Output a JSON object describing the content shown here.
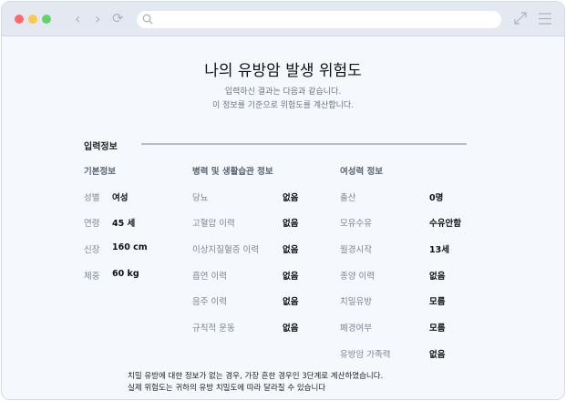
{
  "browser": {
    "controls": [
      "close",
      "minimize",
      "maximize"
    ],
    "url": ""
  },
  "page": {
    "title": "나의 유방암 발생 위험도",
    "subtitle_lines": [
      "입력하신 결과는 다음과 같습니다.",
      "이 정보를 기준으로 위험도를 계산합니다."
    ],
    "section_title": "입력정보"
  },
  "basic": {
    "heading": "기본정보",
    "rows": [
      {
        "label": "성별",
        "value": "여성"
      },
      {
        "label": "연령",
        "value": "45 세"
      },
      {
        "label": "신장",
        "value": "160 cm"
      },
      {
        "label": "체중",
        "value": "60 kg"
      }
    ]
  },
  "history": {
    "heading": "병력 및 생활습관 정보",
    "rows": [
      {
        "label": "당뇨",
        "value": "없음"
      },
      {
        "label": "고혈압 이력",
        "value": "없음"
      },
      {
        "label": "이상지질혈증 이력",
        "value": "없음"
      },
      {
        "label": "흡연 이력",
        "value": "없음"
      },
      {
        "label": "음주 이력",
        "value": "없음"
      },
      {
        "label": "규칙적 운동",
        "value": "없음"
      }
    ]
  },
  "female": {
    "heading": "여성력 정보",
    "rows": [
      {
        "label": "출산",
        "value": "0명"
      },
      {
        "label": "모유수유",
        "value": "수유안함"
      },
      {
        "label": "월경시작",
        "value": "13세"
      },
      {
        "label": "종양 이력",
        "value": "없음"
      },
      {
        "label": "치밀유방",
        "value": "모름"
      },
      {
        "label": "폐경여부",
        "value": "모름"
      },
      {
        "label": "유방암 가족력",
        "value": "없음"
      }
    ]
  },
  "footer": [
    "치밀 유방에 대한 정보가 없는 경우, 가장 흔한 경우인 3단계로 계산하였습니다.",
    "실제 위험도는 귀하의 유방 치밀도에 따라 달라질 수 있습니다"
  ]
}
